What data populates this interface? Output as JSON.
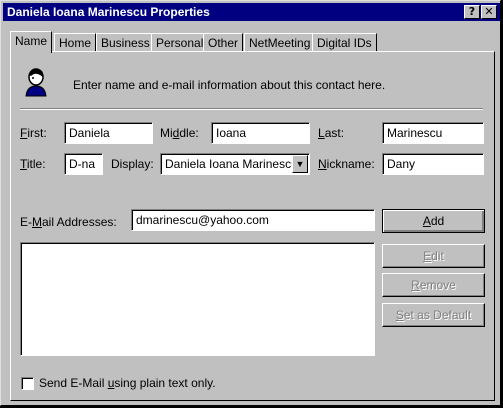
{
  "window": {
    "title": "Daniela Ioana Marinescu Properties",
    "help_button": "?",
    "close_button": "✕"
  },
  "tabs": [
    "Name",
    "Home",
    "Business",
    "Personal",
    "Other",
    "NetMeeting",
    "Digital IDs"
  ],
  "active_tab": "Name",
  "intro_text": "Enter name and e-mail information about this contact here.",
  "fields": {
    "first": {
      "label_key": "F",
      "label_rest": "irst:",
      "value": "Daniela"
    },
    "middle": {
      "label_pre": "Mi",
      "label_key": "d",
      "label_rest": "dle:",
      "value": "Ioana"
    },
    "last": {
      "label_key": "L",
      "label_rest": "ast:",
      "value": "Marinescu"
    },
    "title": {
      "label_key": "T",
      "label_rest": "itle:",
      "value": "D-na"
    },
    "display": {
      "label": "Display:",
      "value": "Daniela Ioana Marinescu"
    },
    "nickname": {
      "label_key": "N",
      "label_rest": "ickname:",
      "value": "Dany"
    }
  },
  "email": {
    "label_pre": "E-",
    "label_key": "M",
    "label_rest": "ail Addresses:",
    "value": "dmarinescu@yahoo.com",
    "list": []
  },
  "buttons": {
    "add": {
      "key": "A",
      "rest": "dd"
    },
    "edit": {
      "key": "E",
      "rest": "dit"
    },
    "remove": {
      "key": "R",
      "rest": "emove"
    },
    "set_default": {
      "key": "S",
      "rest": "et as Default"
    }
  },
  "plain_text": {
    "pre": "Send E-Mail ",
    "key": "u",
    "rest": "sing plain text only.",
    "checked": false
  },
  "colors": {
    "titlebar": "#000080",
    "face": "#c0c0c0"
  },
  "icons": {
    "contact": "contact-person-icon",
    "dropdown": "chevron-down-icon"
  }
}
